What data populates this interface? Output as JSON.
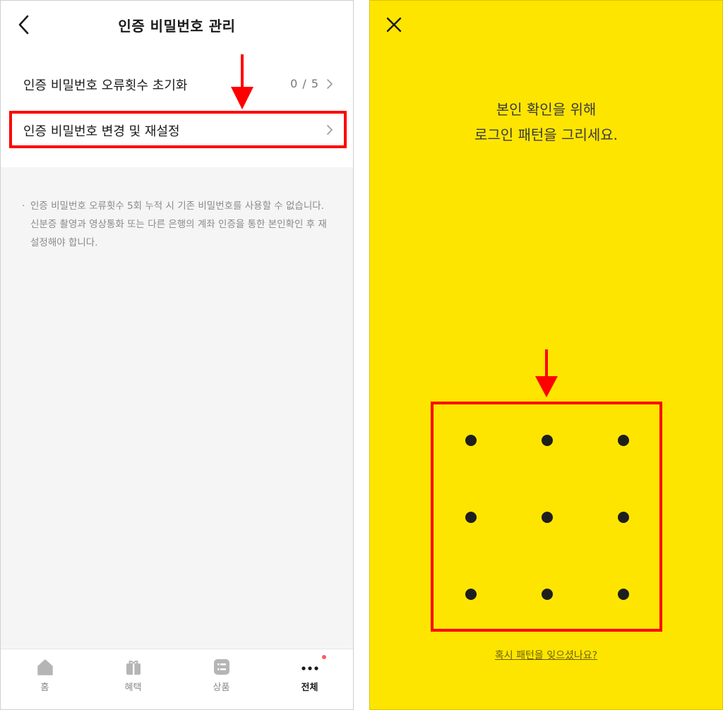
{
  "left": {
    "header": {
      "title": "인증 비밀번호 관리",
      "back_icon": "chevron-left-icon"
    },
    "rows": [
      {
        "label": "인증 비밀번호 오류횟수 초기화",
        "value": "0 / 5",
        "icon": "chevron-right-icon"
      },
      {
        "label": "인증 비밀번호 변경 및 재설정",
        "icon": "chevron-right-icon",
        "highlighted": true
      }
    ],
    "notice": {
      "bullet": "·",
      "text": "인증 비밀번호 오류횟수 5회 누적 시 기존 비밀번호를 사용할 수 없습니다. 신분증 촬영과 영상통화 또는 다른 은행의 계좌 인증을 통한 본인확인 후 재설정해야 합니다."
    },
    "tabbar": [
      {
        "label": "홈",
        "icon": "home-icon"
      },
      {
        "label": "혜택",
        "icon": "gift-icon"
      },
      {
        "label": "상품",
        "icon": "product-list-icon"
      },
      {
        "label": "전체",
        "icon": "more-dots-icon",
        "active": true,
        "badge": true
      }
    ]
  },
  "right": {
    "close_icon": "close-icon",
    "prompt_line1": "본인 확인을 위해",
    "prompt_line2": "로그인 패턴을 그리세요.",
    "pattern_dots": 9,
    "forgot_link": "혹시 패턴을 잊으셨나요?"
  },
  "colors": {
    "highlight": "#ff0000",
    "background_yellow": "#fee500",
    "info_background": "#f5f5f5",
    "badge": "#ff5a5a"
  }
}
